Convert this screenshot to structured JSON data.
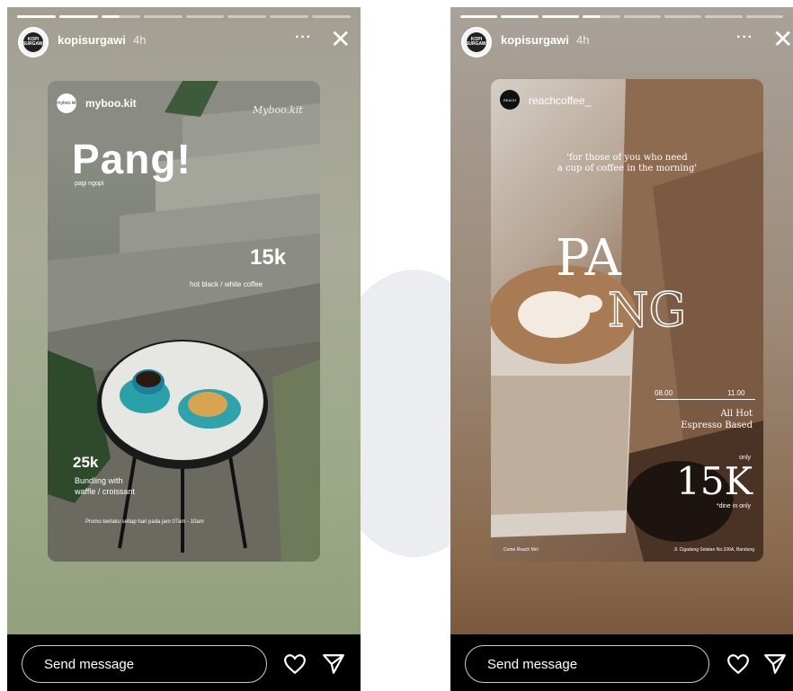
{
  "story_left": {
    "username": "kopisurgawi",
    "time": "4h",
    "more_label": "···",
    "close_label": "✕",
    "send_placeholder": "Send message",
    "avatar_text": "KOPI SURGAWI",
    "post": {
      "account": "myboo.kit",
      "account_logo_text": "myboo.kit",
      "brand": "Myboo.kit",
      "headline": "Pang!",
      "subheadline": "pagi ngopi",
      "price1": "15k",
      "price1_desc": "hot black / white coffee",
      "price2": "25k",
      "price2_desc_line1": "Bundling with",
      "price2_desc_line2": "waffle / croissant",
      "promo": "Promo berlaku setiap hari pada jam 07am - 10am"
    }
  },
  "story_right": {
    "username": "kopisurgawi",
    "time": "4h",
    "more_label": "···",
    "close_label": "✕",
    "send_placeholder": "Send message",
    "avatar_text": "KOPI SURGAWI",
    "post": {
      "account": "reachcoffee_",
      "account_logo_text": "REACH",
      "quote_line1": "'for those of you who need",
      "quote_line2": "a cup of coffee in the morning'",
      "headline_top": "PA",
      "headline_bottom": "NG",
      "time_start": "08.00",
      "time_end": "11.00",
      "offer_line1": "All Hot",
      "offer_line2": "Espresso Based",
      "only_label": "only",
      "price": "15K",
      "dine_note": "*dine in only",
      "footer_left": "Come Reach Me!",
      "footer_right": "Jl. Cigadung Selatan No.106A, Bandung"
    }
  },
  "colors": {
    "footer_bg": "#000000",
    "text": "#ffffff"
  }
}
